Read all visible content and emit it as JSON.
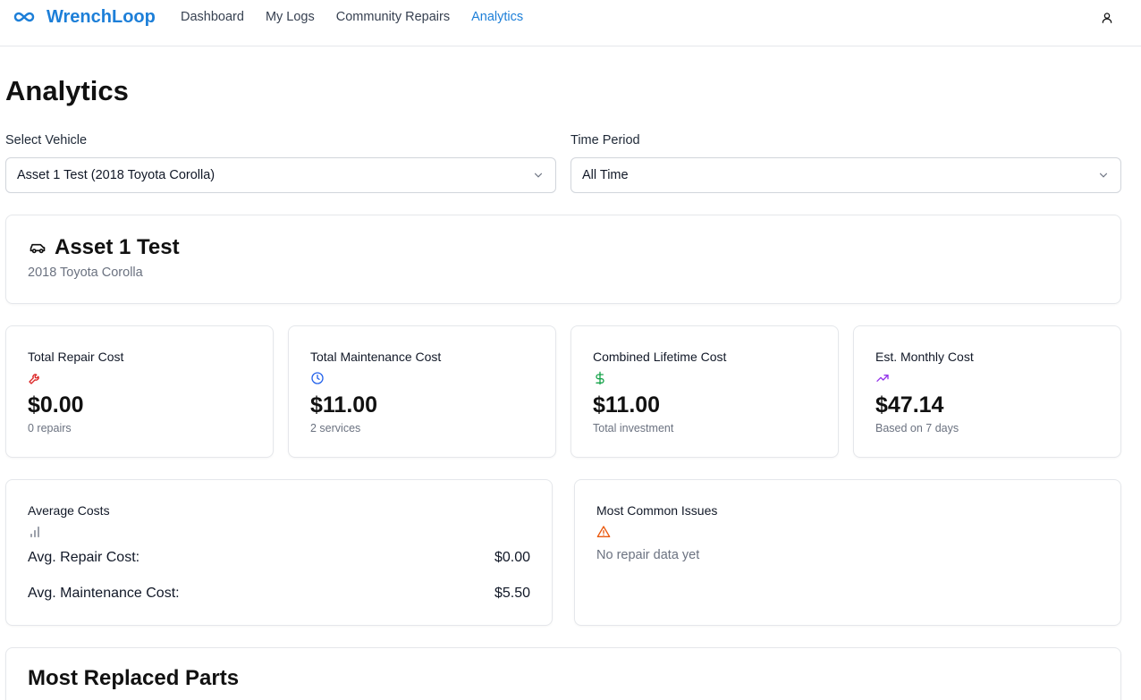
{
  "app": {
    "name": "WrenchLoop"
  },
  "nav": {
    "items": [
      {
        "label": "Dashboard",
        "active": false
      },
      {
        "label": "My Logs",
        "active": false
      },
      {
        "label": "Community Repairs",
        "active": false
      },
      {
        "label": "Analytics",
        "active": true
      }
    ]
  },
  "page": {
    "title": "Analytics"
  },
  "filters": {
    "vehicle_label": "Select Vehicle",
    "vehicle_value": "Asset 1 Test (2018 Toyota Corolla)",
    "period_label": "Time Period",
    "period_value": "All Time"
  },
  "vehicle": {
    "name": "Asset 1 Test",
    "subtitle": "2018 Toyota Corolla",
    "icon": "car-icon"
  },
  "stats": [
    {
      "title": "Total Repair Cost",
      "value": "$0.00",
      "sub": "0 repairs",
      "icon": "wrench-icon",
      "color": "#dc2626"
    },
    {
      "title": "Total Maintenance Cost",
      "value": "$11.00",
      "sub": "2 services",
      "icon": "clock-icon",
      "color": "#2563eb"
    },
    {
      "title": "Combined Lifetime Cost",
      "value": "$11.00",
      "sub": "Total investment",
      "icon": "dollar-icon",
      "color": "#16a34a"
    },
    {
      "title": "Est. Monthly Cost",
      "value": "$47.14",
      "sub": "Based on 7 days",
      "icon": "trending-up-icon",
      "color": "#9333ea"
    }
  ],
  "averages": {
    "title": "Average Costs",
    "icon": "bar-chart-icon",
    "rows": [
      {
        "label": "Avg. Repair Cost:",
        "value": "$0.00"
      },
      {
        "label": "Avg. Maintenance Cost:",
        "value": "$5.50"
      }
    ]
  },
  "issues": {
    "title": "Most Common Issues",
    "icon": "warning-icon",
    "empty_text": "No repair data yet",
    "color": "#ea580c"
  },
  "parts": {
    "title": "Most Replaced Parts"
  },
  "colors": {
    "accent": "#1d7fd8"
  }
}
